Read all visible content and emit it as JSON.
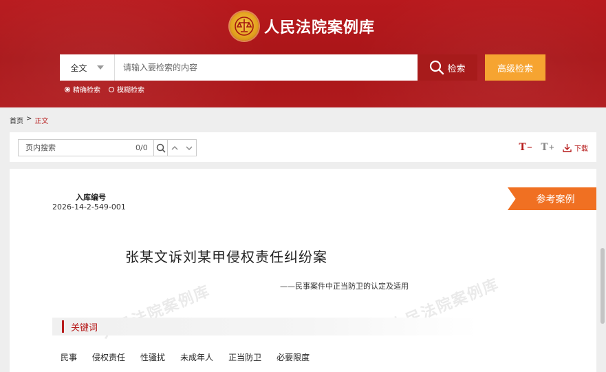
{
  "header": {
    "site_title": "人民法院案例库",
    "search": {
      "scope": "全文",
      "placeholder": "请输入要检索的内容",
      "search_label": "检索",
      "advanced_label": "高级检索"
    },
    "match_options": [
      {
        "label": "精确检索",
        "selected": true
      },
      {
        "label": "模糊检索",
        "selected": false
      }
    ]
  },
  "breadcrumb": {
    "home": "首页",
    "separator": ">",
    "current": "正文"
  },
  "toolbar": {
    "in_page_placeholder": "页内搜索",
    "match_count": "0/0",
    "font_decrease": "T",
    "font_decrease_sign": "−",
    "font_increase": "T",
    "font_increase_sign": "+",
    "download_label": "下载"
  },
  "case": {
    "entry_label": "入库编号",
    "entry_no": "2026-14-2-549-001",
    "ribbon_label": "参考案例",
    "title": "张某文诉刘某甲侵权责任纠纷案",
    "subtitle": "——民事案件中正当防卫的认定及适用",
    "keywords_heading": "关键词",
    "keywords": [
      "民事",
      "侵权责任",
      "性骚扰",
      "未成年人",
      "正当防卫",
      "必要限度"
    ],
    "watermark": "人民法院案例库"
  },
  "colors": {
    "header_red": "#b01a1d",
    "search_button": "#a71b1b",
    "advanced_button": "#f6a431",
    "ribbon": "#f07022",
    "accent_red": "#b71c1c"
  }
}
